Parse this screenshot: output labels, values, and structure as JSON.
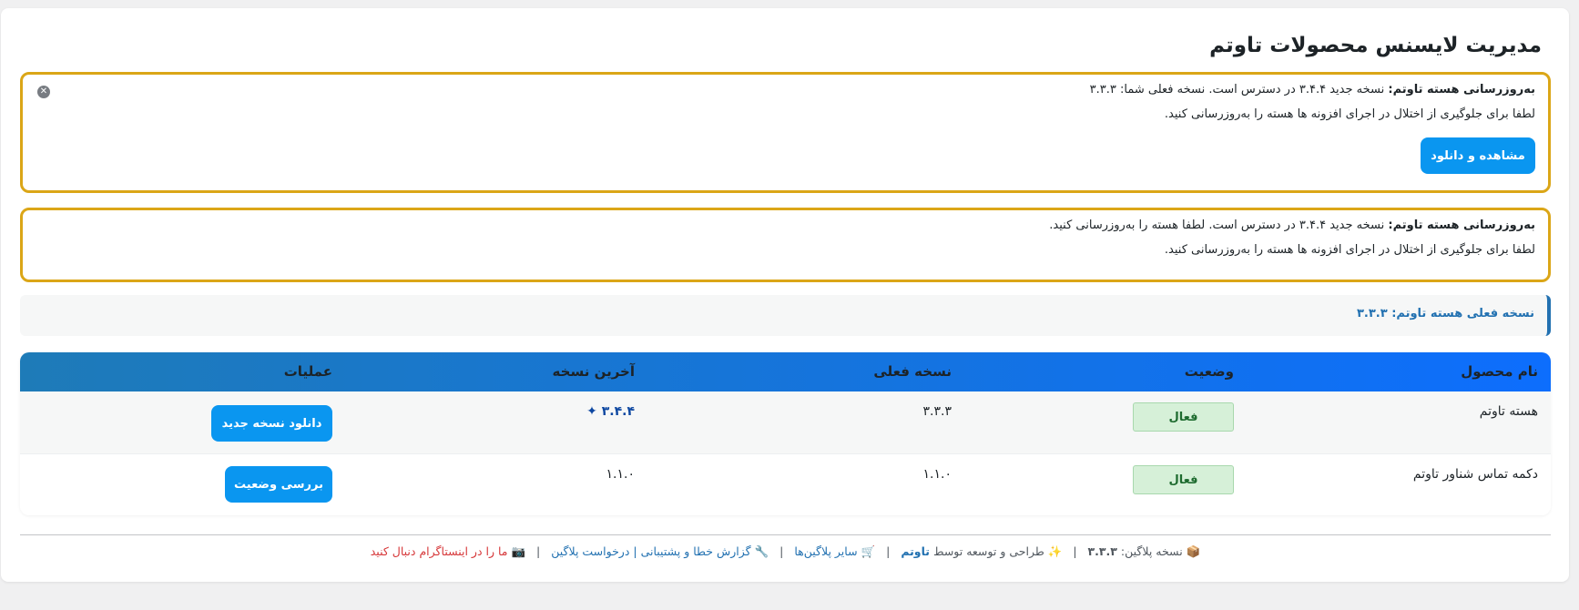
{
  "page": {
    "title": "مدیریت لایسنس محصولات تاوتم"
  },
  "notice1": {
    "bold": "به‌روزرسانی هسته تاوتم:",
    "line1": "نسخه جدید ۳.۴.۴ در دسترس است. نسخه فعلی شما: ۳.۳.۳",
    "line2": "لطفا برای جلوگیری از اختلال در اجرای افزونه ها هسته را به‌روزرسانی کنید.",
    "button": "مشاهده و دانلود",
    "dismiss_icon": "close-circle-icon"
  },
  "notice2": {
    "bold": "به‌روزرسانی هسته تاوتم:",
    "line1": "نسخه جدید ۳.۴.۴ در دسترس است. لطفا هسته را به‌روزرسانی کنید.",
    "line2": "لطفا برای جلوگیری از اختلال در اجرای افزونه ها هسته را به‌روزرسانی کنید."
  },
  "info": {
    "text": "نسخه فعلی هسته تاوتم: ۳.۳.۳"
  },
  "table": {
    "headers": {
      "name": "نام محصول",
      "status": "وضعیت",
      "current": "نسخه فعلی",
      "latest": "آخرین نسخه",
      "actions": "عملیات"
    },
    "rows": [
      {
        "name": "هسته تاوتم",
        "status": "فعال",
        "current": "۳.۳.۳",
        "latest": "۳.۴.۴ ✦",
        "action": "دانلود نسخه جدید"
      },
      {
        "name": "دکمه تماس شناور تاوتم",
        "status": "فعال",
        "current": "۱.۱.۰",
        "latest": "۱.۱.۰",
        "action": "بررسی وضعیت"
      }
    ]
  },
  "footer": {
    "version_icon": "📦",
    "version_label": "نسخه پلاگین:",
    "version_value": "۳.۳.۳",
    "design_icon": "✨",
    "design_label": "طراحی و توسعه توسط",
    "brand": "تاوتم",
    "plugins_icon": "🛒",
    "plugins_link": "سایر پلاگین‌ها",
    "report_icon": "🔧",
    "report_link": "گزارش خطا و پشتیبانی | درخواست پلاگین",
    "insta_icon": "📷",
    "insta_link": "ما را در اینستاگرام دنبال کنید",
    "separator": "|"
  },
  "colors": {
    "notice_border": "#dba617",
    "primary_button": "#0a96f0",
    "header_gradient_start": "#0d6efd",
    "header_gradient_end": "#1e7bb8",
    "active_badge_bg": "#d6f0d8",
    "info_accent": "#2271b1",
    "instagram_link": "#d63638"
  }
}
